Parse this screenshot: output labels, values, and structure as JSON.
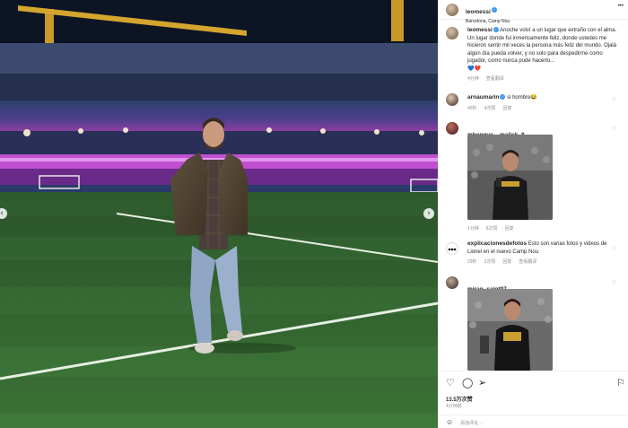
{
  "post": {
    "user": "leomessi",
    "location": "Barcelona, Camp Nou",
    "more_label": "•••",
    "caption": "Anoche volví a un lugar que extraño con el alma. Un lugar donde fui inmensamente feliz, donde ustedes me hicieron sentir mil veces la persona más feliz del mundo. Ojalá algún día pueda volver, y no solo para despedirme como jugador, como nunca pude hacerlo...",
    "caption_emojis": "💙❤️",
    "caption_time": "4分钟",
    "caption_translate": "查看翻译"
  },
  "comments": [
    {
      "user": "arnaumarin",
      "text": "si hombre😂",
      "time": "45秒",
      "likes": "4次赞",
      "reply": "回复"
    },
    {
      "user": "mbengue__malick_8",
      "text": "",
      "time": "1分钟",
      "likes": "8次赞",
      "reply": "回复"
    },
    {
      "user": "explicacionesdefotos",
      "text": "Esto son varias fotos y videos de Lionel en el nuevo Camp Nou",
      "time": "29秒",
      "likes": "3次赞",
      "reply": "回复",
      "translate": "查看翻译"
    },
    {
      "user": "miran_saint97",
      "text": ""
    }
  ],
  "footer": {
    "likes": "13.5万次赞",
    "time": "4分钟前",
    "add_comment_placeholder": "添加评论…"
  },
  "icons": {
    "like": "heart-icon",
    "comment": "comment-icon",
    "share": "paper-plane-icon",
    "save": "bookmark-icon"
  },
  "colors": {
    "verified": "#3897f0",
    "heart_red": "#ed4956",
    "heart_blue": "#3897f0"
  }
}
